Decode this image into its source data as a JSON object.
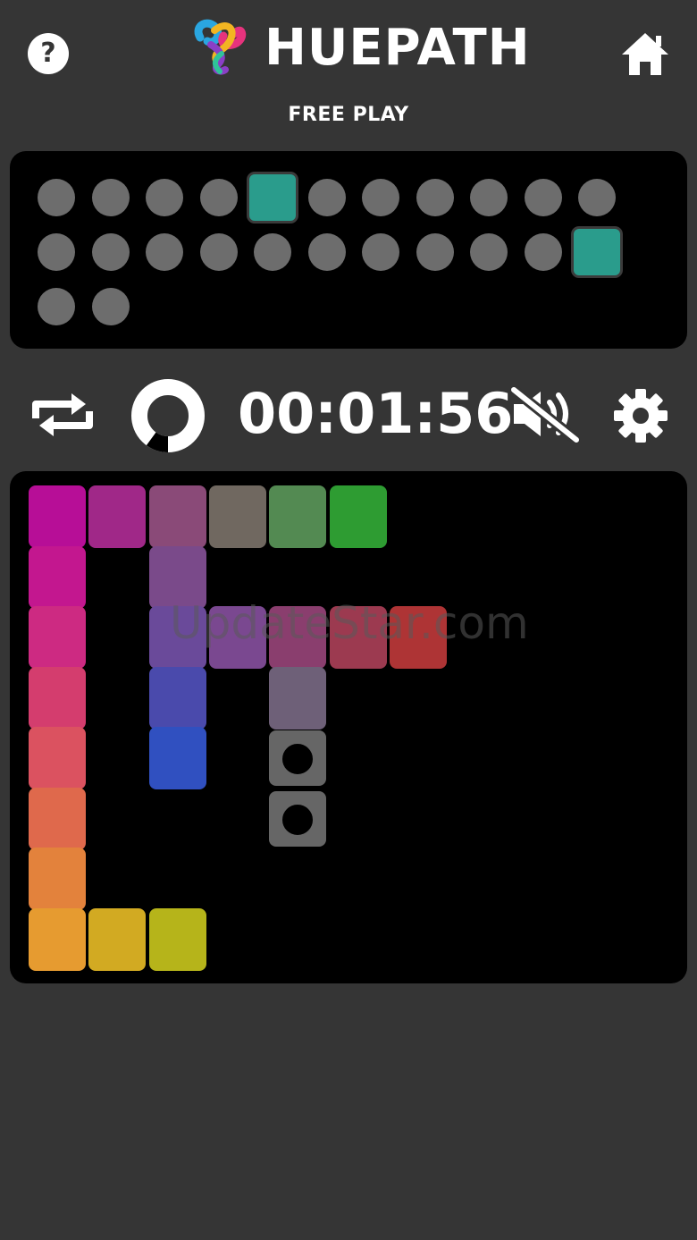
{
  "header": {
    "title": "HUEPATH",
    "mode": "FREE PLAY",
    "help_label": "?",
    "help_icon": "help-circle-icon",
    "home_icon": "home-icon",
    "logo_icon": "braided-ribbon-logo"
  },
  "progress": {
    "total_levels": 24,
    "marked_levels": [
      4,
      21
    ]
  },
  "toolbar": {
    "timer": "00:01:56",
    "restart_icon": "repeat-icon",
    "hint_icon": "progress-ring-icon",
    "hint_progress": 0.1,
    "sound_icon": "sound-muted-icon",
    "settings_icon": "gear-icon"
  },
  "board": {
    "tiles": [
      {
        "col": 0,
        "row": 0,
        "color": "#b70e97"
      },
      {
        "col": 1,
        "row": 0,
        "color": "#a02888"
      },
      {
        "col": 2,
        "row": 0,
        "color": "#8a4a78"
      },
      {
        "col": 3,
        "row": 0,
        "color": "#706860"
      },
      {
        "col": 4,
        "row": 0,
        "color": "#538a52"
      },
      {
        "col": 5,
        "row": 0,
        "color": "#2e9c32"
      },
      {
        "col": 0,
        "row": 1,
        "color": "#c3178f"
      },
      {
        "col": 2,
        "row": 1,
        "color": "#7a4a8a"
      },
      {
        "col": 0,
        "row": 2,
        "color": "#cd2a82"
      },
      {
        "col": 2,
        "row": 2,
        "color": "#6a4a9a"
      },
      {
        "col": 3,
        "row": 2,
        "color": "#7a4890"
      },
      {
        "col": 4,
        "row": 2,
        "color": "#8a3e6e"
      },
      {
        "col": 5,
        "row": 2,
        "color": "#9c3a50"
      },
      {
        "col": 6,
        "row": 2,
        "color": "#ae3435"
      },
      {
        "col": 0,
        "row": 3,
        "color": "#d43d6e"
      },
      {
        "col": 2,
        "row": 3,
        "color": "#4a4aac"
      },
      {
        "col": 4,
        "row": 3,
        "color": "#6e6078"
      },
      {
        "col": 0,
        "row": 4,
        "color": "#db5260"
      },
      {
        "col": 2,
        "row": 4,
        "color": "#3050c0"
      },
      {
        "col": 0,
        "row": 5,
        "color": "#df694c"
      },
      {
        "col": 0,
        "row": 6,
        "color": "#e3823c"
      },
      {
        "col": 0,
        "row": 7,
        "color": "#e69b30"
      },
      {
        "col": 1,
        "row": 7,
        "color": "#d2aa22"
      },
      {
        "col": 2,
        "row": 7,
        "color": "#b6b41a"
      }
    ],
    "empty_slots": [
      {
        "col": 4,
        "row": 4
      },
      {
        "col": 4,
        "row": 5
      }
    ],
    "slot_color": "#666666"
  },
  "watermark": "UpdateStar.com"
}
